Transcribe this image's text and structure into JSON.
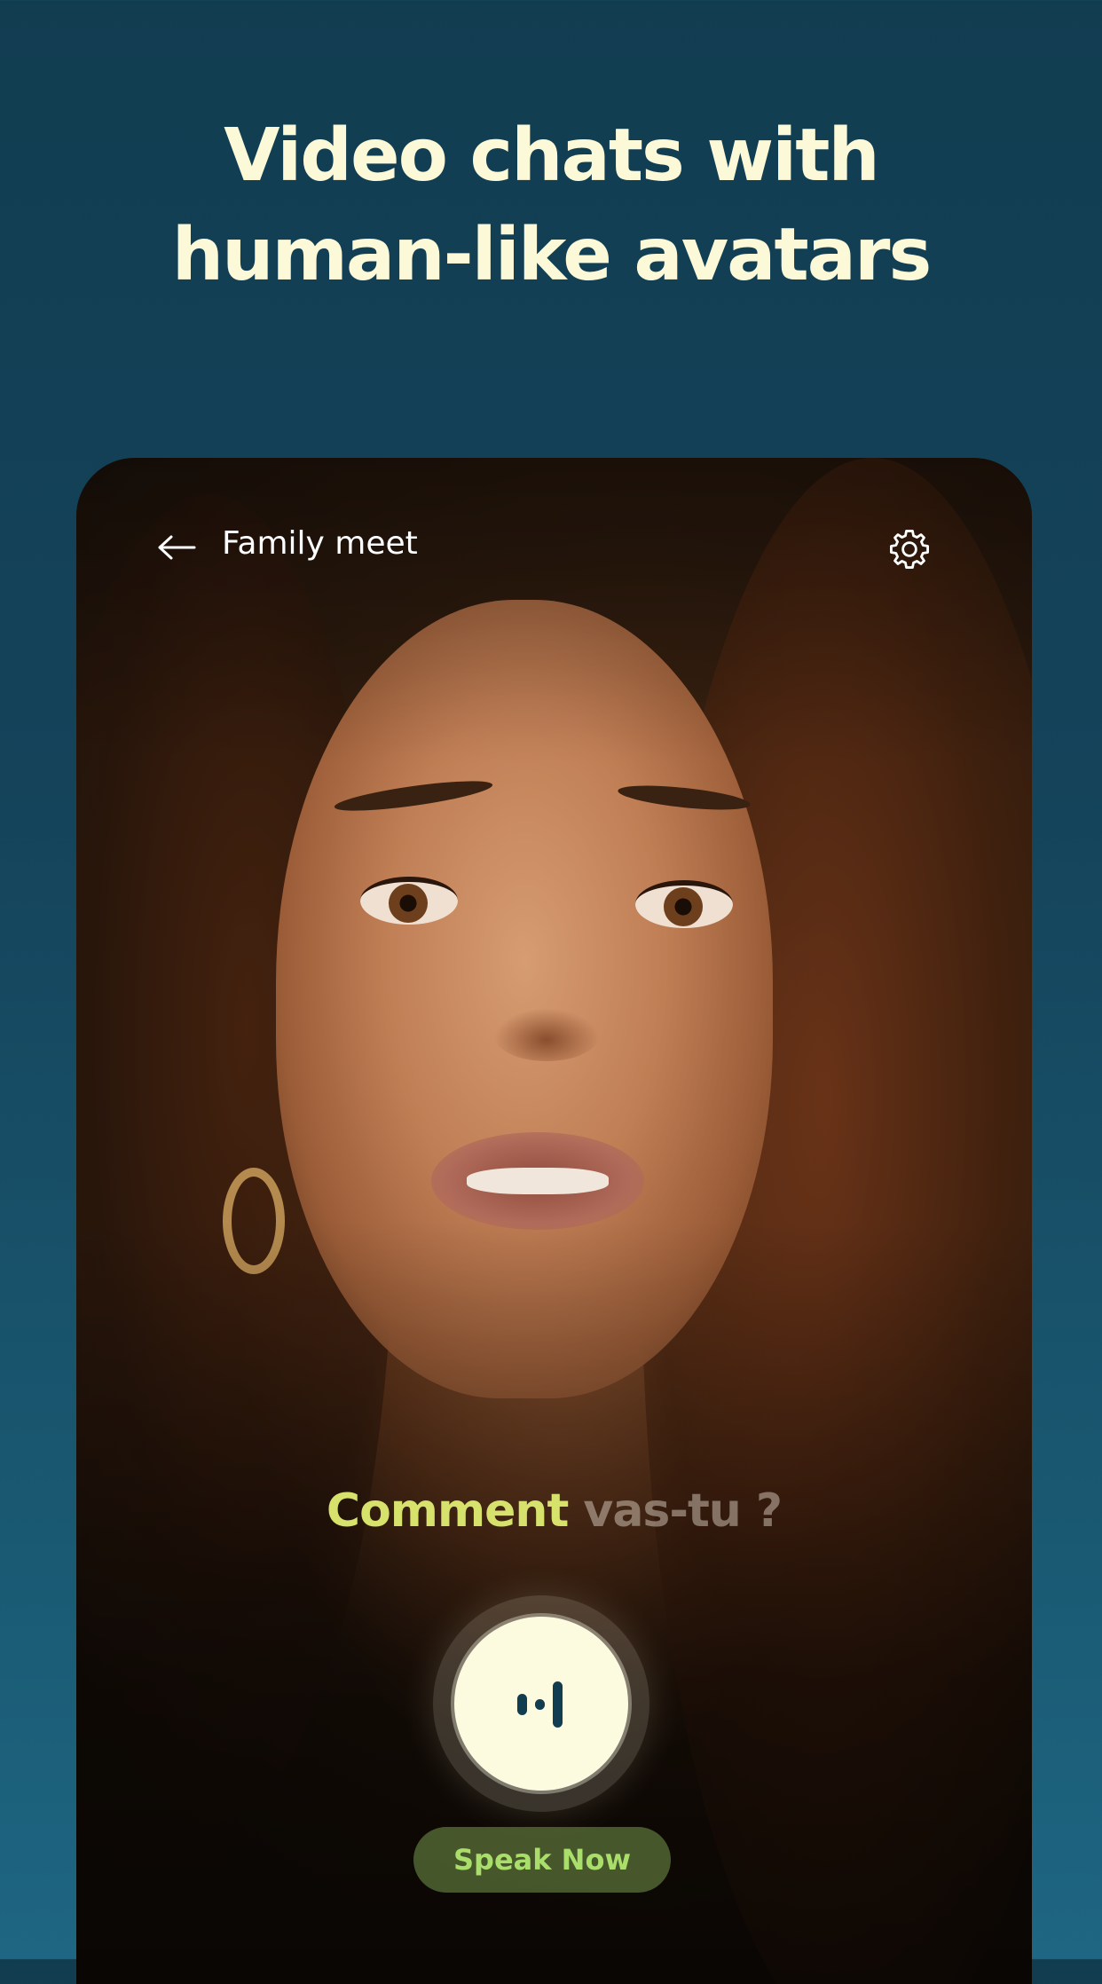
{
  "headline": {
    "line1": "Video chats with",
    "line2": "human-like avatars"
  },
  "call": {
    "title": "Family meet",
    "back_icon": "arrow-left-icon",
    "settings_icon": "gear-icon",
    "caption": {
      "spoken": "Comment",
      "pending": "vas-tu ?"
    },
    "mic_icon": "audio-waveform-icon",
    "speak_label": "Speak Now"
  },
  "colors": {
    "background": "#14435a",
    "headline_text": "#fbf9d8",
    "caption_spoken": "#d7e26d",
    "mic_button": "#fcfbe0",
    "speak_label": "#a9de6a"
  }
}
